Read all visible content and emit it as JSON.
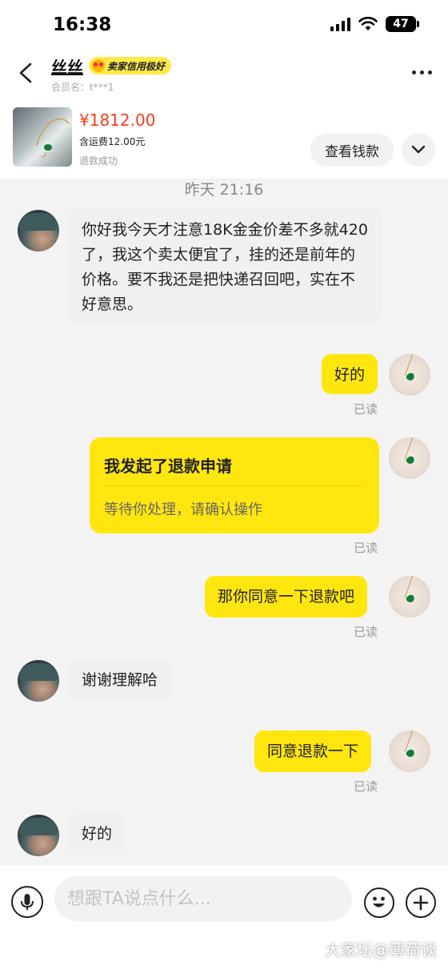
{
  "status_bar": {
    "time": "16:38",
    "battery": "47"
  },
  "header": {
    "contact_name": "丝丝",
    "credit_badge": "卖家信用极好",
    "member_name": "会员名：t***1",
    "icons": {
      "back": "chevron-left-icon",
      "more": "more-dots-icon",
      "badge": "heart-eyes-emoji-icon"
    }
  },
  "product": {
    "price": "¥1812.00",
    "shipping": "含运费12.00元",
    "status": "退款成功",
    "view_payment_label": "查看钱款",
    "expand_icon": "chevron-down-icon"
  },
  "chat": {
    "timestamp": "昨天 21:16",
    "messages": [
      {
        "side": "left",
        "text": "你好我今天才注意18K金金价差不多就420了，我这个卖太便宜了，挂的还是前年的价格。要不我还是把快递召回吧，实在不好意思。"
      },
      {
        "side": "right",
        "text": "好的",
        "read": "已读"
      },
      {
        "side": "right",
        "card_title": "我发起了退款申请",
        "card_subtitle": "等待你处理，请确认操作",
        "read": "已读"
      },
      {
        "side": "right",
        "text": "那你同意一下退款吧",
        "read": "已读"
      },
      {
        "side": "left",
        "text": "谢谢理解哈"
      },
      {
        "side": "right",
        "text": "同意退款一下",
        "read": "已读"
      },
      {
        "side": "left",
        "text": "好的"
      }
    ]
  },
  "input_bar": {
    "placeholder": "想跟TA说点什么...",
    "icons": {
      "mic": "microphone-icon",
      "emoji": "smiley-icon",
      "plus": "plus-icon"
    }
  },
  "watermark": "大家坛@薄荷谈",
  "colors": {
    "accent_yellow": "#ffe60f",
    "price_red": "#ff3b1f",
    "background": "#f3f3f3"
  }
}
